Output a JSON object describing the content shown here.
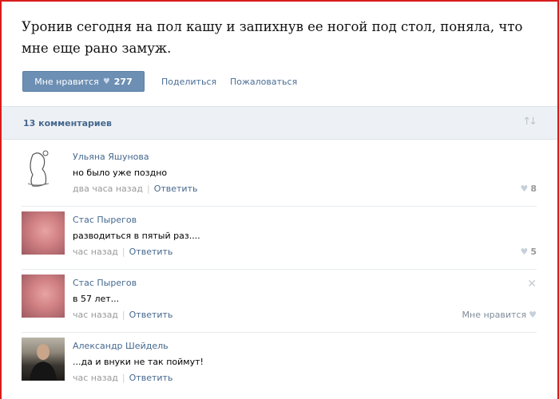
{
  "post": {
    "text": "Уронив сегодня на пол кашу и запихнув ее ногой под стол, поняла, что мне еще рано замуж.",
    "like_label": "Мне нравится",
    "like_icon": "heart-icon",
    "like_count": "277",
    "share_label": "Поделиться",
    "report_label": "Пожаловаться"
  },
  "comments_header": {
    "count_label": "13 комментариев",
    "sort_icon": "sort-icon"
  },
  "comments": [
    {
      "author": "Ульяна Яшунова",
      "text": "но было уже поздно",
      "time": "два часа назад",
      "reply_label": "Ответить",
      "likes": "8"
    },
    {
      "author": "Стас Пырегов",
      "text": "разводиться в пятый раз....",
      "time": "час назад",
      "reply_label": "Ответить",
      "likes": "5"
    },
    {
      "author": "Стас Пырегов",
      "text": "в 57 лет...",
      "time": "час назад",
      "reply_label": "Ответить",
      "like_label": "Мне нравится"
    },
    {
      "author": "Александр Шейдель",
      "text": "...да и внуки не так поймут!",
      "time": "час назад",
      "reply_label": "Ответить"
    }
  ],
  "colors": {
    "frame": "#d91c1c",
    "like_button": "#6d8fb3",
    "link": "#45688e",
    "header_bg": "#edf1f5"
  }
}
